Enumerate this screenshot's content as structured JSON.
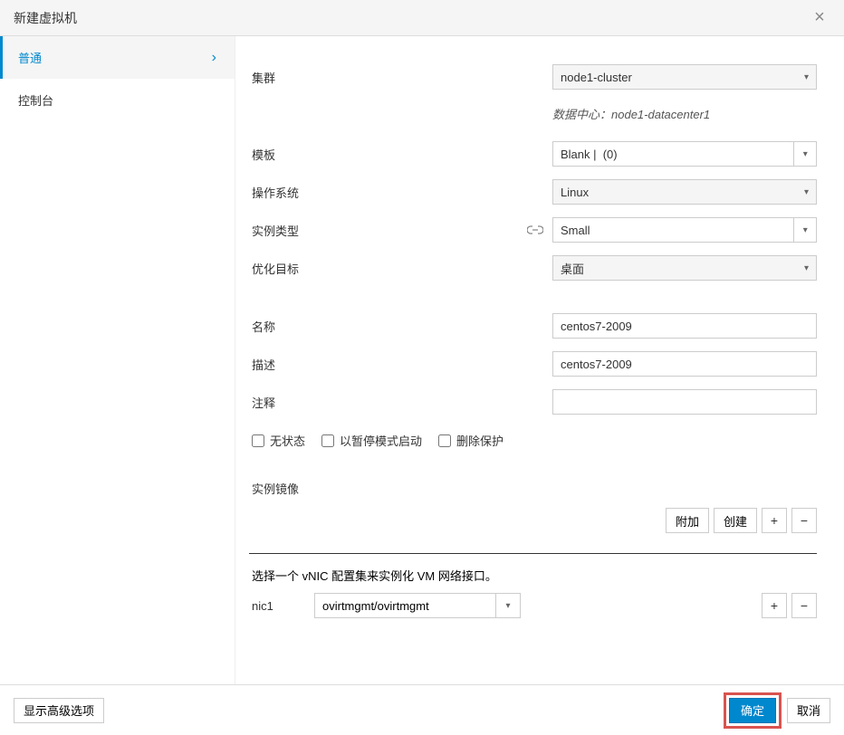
{
  "header": {
    "title": "新建虚拟机"
  },
  "sidebar": {
    "items": [
      {
        "label": "普通",
        "active": true
      },
      {
        "label": "控制台",
        "active": false
      }
    ]
  },
  "form": {
    "cluster": {
      "label": "集群",
      "value": "node1-cluster",
      "hint": "数据中心：node1-datacenter1"
    },
    "template": {
      "label": "模板",
      "value": "Blank |  (0)"
    },
    "os": {
      "label": "操作系统",
      "value": "Linux"
    },
    "instance_type": {
      "label": "实例类型",
      "value": "Small"
    },
    "optimized_for": {
      "label": "优化目标",
      "value": "桌面"
    },
    "name": {
      "label": "名称",
      "value": "centos7-2009"
    },
    "description": {
      "label": "描述",
      "value": "centos7-2009"
    },
    "comment": {
      "label": "注释",
      "value": ""
    },
    "stateless": "无状态",
    "start_paused": "以暂停模式启动",
    "delete_protection": "删除保护",
    "instance_images": "实例镜像",
    "attach": "附加",
    "create": "创建",
    "vnic_hint": "选择一个 vNIC 配置集来实例化 VM 网络接口。",
    "nic": {
      "label": "nic1",
      "value": "ovirtmgmt/ovirtmgmt"
    }
  },
  "footer": {
    "advanced": "显示高级选项",
    "ok": "确定",
    "cancel": "取消"
  }
}
